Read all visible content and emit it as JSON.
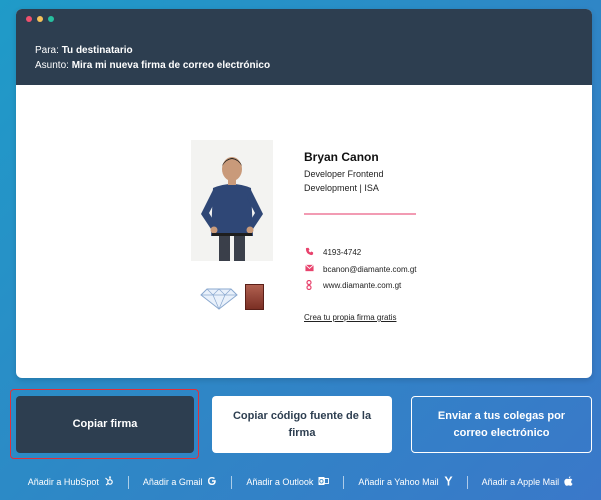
{
  "email": {
    "to_label": "Para:",
    "to_value": "Tu destinatario",
    "subject_label": "Asunto:",
    "subject_value": "Mira mi nueva firma de correo electrónico"
  },
  "signature": {
    "name": "Bryan Canon",
    "role_line1": "Developer Frontend",
    "role_line2": "Development | ISA",
    "phone": "4193-4742",
    "email": "bcanon@diamante.com.gt",
    "website": "www.diamante.com.gt",
    "promo_link": "Crea tu propia firma gratis",
    "logo_text": "Diamante",
    "accent_color": "#e8436d"
  },
  "actions": {
    "copy_signature": "Copiar firma",
    "copy_source": "Copiar código fuente de la firma",
    "send_colleagues": "Enviar a tus colegas por correo electrónico"
  },
  "integrations": [
    {
      "label": "Añadir a HubSpot",
      "icon": "hubspot-icon"
    },
    {
      "label": "Añadir a Gmail",
      "icon": "gmail-icon"
    },
    {
      "label": "Añadir a Outlook",
      "icon": "outlook-icon"
    },
    {
      "label": "Añadir a Yahoo Mail",
      "icon": "yahoo-icon"
    },
    {
      "label": "Añadir a Apple Mail",
      "icon": "apple-icon"
    }
  ]
}
